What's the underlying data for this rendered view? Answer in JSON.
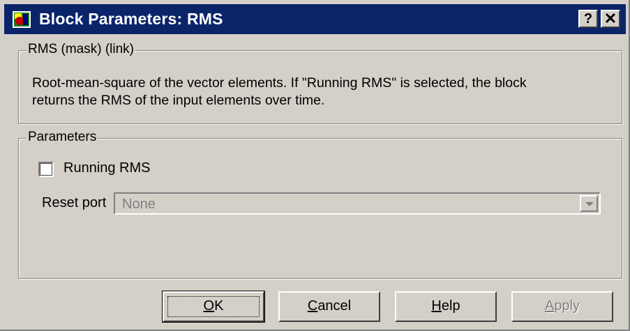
{
  "window": {
    "title": "Block Parameters: RMS",
    "help_glyph": "?",
    "close_glyph": "✕"
  },
  "description_group": {
    "legend": "RMS (mask) (link)",
    "line1": "Root-mean-square of the vector elements.  If \"Running RMS\" is selected, the block",
    "line2": "returns the RMS of the input elements over time."
  },
  "parameters_group": {
    "legend": "Parameters",
    "running_rms_label": "Running RMS",
    "running_rms_checked": false,
    "reset_port_label": "Reset port",
    "reset_port_value": "None"
  },
  "buttons": {
    "ok_first": "O",
    "ok_rest": "K",
    "cancel_first": "C",
    "cancel_rest": "ancel",
    "help_first": "H",
    "help_rest": "elp",
    "apply_first": "A",
    "apply_rest": "pply"
  }
}
